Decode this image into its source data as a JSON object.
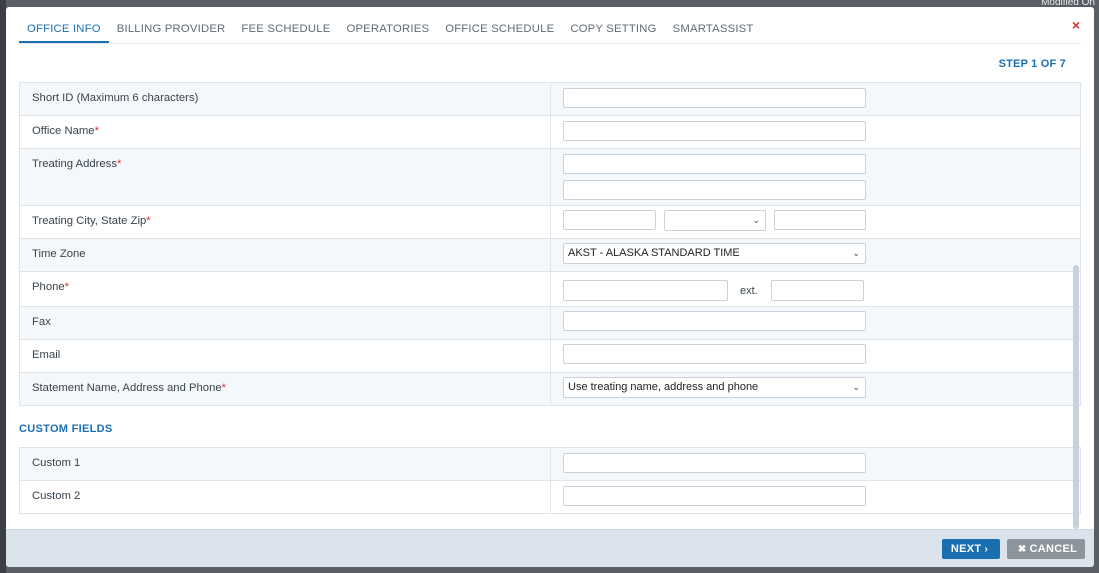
{
  "background": {
    "corner_text": "Modified On"
  },
  "tabs": [
    {
      "label": "OFFICE INFO",
      "active": true
    },
    {
      "label": "BILLING PROVIDER"
    },
    {
      "label": "FEE SCHEDULE"
    },
    {
      "label": "OPERATORIES"
    },
    {
      "label": "OFFICE SCHEDULE"
    },
    {
      "label": "COPY SETTING"
    },
    {
      "label": "SMARTASSIST"
    }
  ],
  "close_icon": "×",
  "step_label": "STEP 1 OF 7",
  "fields": {
    "short_id": {
      "label": "Short ID (Maximum 6 characters)",
      "value": ""
    },
    "office_name": {
      "label": "Office Name",
      "required": "*",
      "value": ""
    },
    "treating_address": {
      "label": "Treating Address",
      "required": "*",
      "line1": "",
      "line2": ""
    },
    "city_state_zip": {
      "label": "Treating City, State Zip",
      "required": "*",
      "city": "",
      "state": "",
      "zip": ""
    },
    "time_zone": {
      "label": "Time Zone",
      "value": "AKST - ALASKA STANDARD TIME"
    },
    "phone": {
      "label": "Phone",
      "required": "*",
      "value": "",
      "ext_label": "ext.",
      "ext_value": ""
    },
    "fax": {
      "label": "Fax",
      "value": ""
    },
    "email": {
      "label": "Email",
      "value": ""
    },
    "statement": {
      "label": "Statement Name, Address and Phone",
      "required": "*",
      "value": "Use treating name, address and phone"
    }
  },
  "custom_fields": {
    "heading": "CUSTOM FIELDS",
    "custom1": {
      "label": "Custom 1",
      "value": ""
    },
    "custom2": {
      "label": "Custom 2",
      "value": ""
    }
  },
  "footer": {
    "next_label": "NEXT",
    "next_icon": "›",
    "cancel_label": "CANCEL",
    "cancel_icon": "✖"
  },
  "colors": {
    "accent": "#1a6fb0",
    "required": "#d9302f",
    "cancel": "#8c949c"
  }
}
